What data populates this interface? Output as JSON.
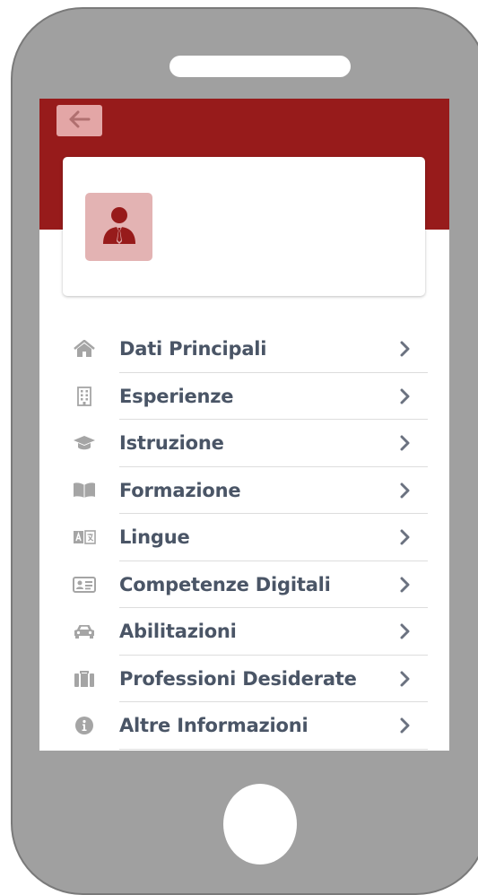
{
  "header": {
    "back_label": "back"
  },
  "profile": {
    "avatar": "user-tie-icon"
  },
  "menu": {
    "items": [
      {
        "label": "Dati Principali",
        "icon": "home-icon"
      },
      {
        "label": "Esperienze",
        "icon": "building-icon"
      },
      {
        "label": "Istruzione",
        "icon": "graduation-cap-icon"
      },
      {
        "label": "Formazione",
        "icon": "book-open-icon"
      },
      {
        "label": "Lingue",
        "icon": "language-icon"
      },
      {
        "label": "Competenze Digitali",
        "icon": "id-card-icon"
      },
      {
        "label": "Abilitazioni",
        "icon": "car-icon"
      },
      {
        "label": "Professioni Desiderate",
        "icon": "suitcase-icon"
      },
      {
        "label": "Altre Informazioni",
        "icon": "info-circle-icon"
      }
    ]
  },
  "colors": {
    "brand": "#971b1b",
    "back_button": "#e3a6a6",
    "avatar_bg": "#e3b3b3",
    "icon": "#a5a5a5",
    "text": "#4a5566",
    "chevron": "#6b7280"
  }
}
